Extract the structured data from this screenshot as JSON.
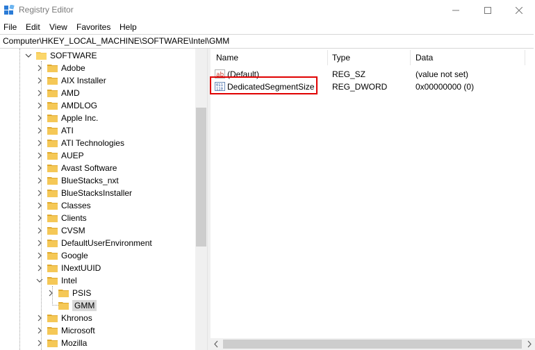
{
  "window": {
    "title": "Registry Editor"
  },
  "menu": [
    "File",
    "Edit",
    "View",
    "Favorites",
    "Help"
  ],
  "address": "Computer\\HKEY_LOCAL_MACHINE\\SOFTWARE\\Intel\\GMM",
  "tree": [
    {
      "label": "SOFTWARE",
      "expanded": true
    },
    {
      "label": "Adobe"
    },
    {
      "label": "AIX Installer"
    },
    {
      "label": "AMD"
    },
    {
      "label": "AMDLOG"
    },
    {
      "label": "Apple Inc."
    },
    {
      "label": "ATI"
    },
    {
      "label": "ATI Technologies"
    },
    {
      "label": "AUEP"
    },
    {
      "label": "Avast Software"
    },
    {
      "label": "BlueStacks_nxt"
    },
    {
      "label": "BlueStacksInstaller"
    },
    {
      "label": "Classes"
    },
    {
      "label": "Clients"
    },
    {
      "label": "CVSM"
    },
    {
      "label": "DefaultUserEnvironment"
    },
    {
      "label": "Google"
    },
    {
      "label": "INextUUID"
    },
    {
      "label": "Intel",
      "expanded": true
    },
    {
      "label": "PSIS"
    },
    {
      "label": "GMM",
      "selected": true
    },
    {
      "label": "Khronos"
    },
    {
      "label": "Microsoft"
    },
    {
      "label": "Mozilla"
    }
  ],
  "columns": {
    "name": "Name",
    "type": "Type",
    "data": "Data"
  },
  "values": [
    {
      "name": "(Default)",
      "type": "REG_SZ",
      "data": "(value not set)",
      "icon": "string-value-icon"
    },
    {
      "name": "DedicatedSegmentSize",
      "type": "REG_DWORD",
      "data": "0x00000000 (0)",
      "icon": "binary-value-icon"
    }
  ],
  "colors": {
    "folder": "#f5c857",
    "folder_dark": "#e0a92d",
    "selection": "#d9d9d9",
    "highlight_border": "#e00000"
  }
}
